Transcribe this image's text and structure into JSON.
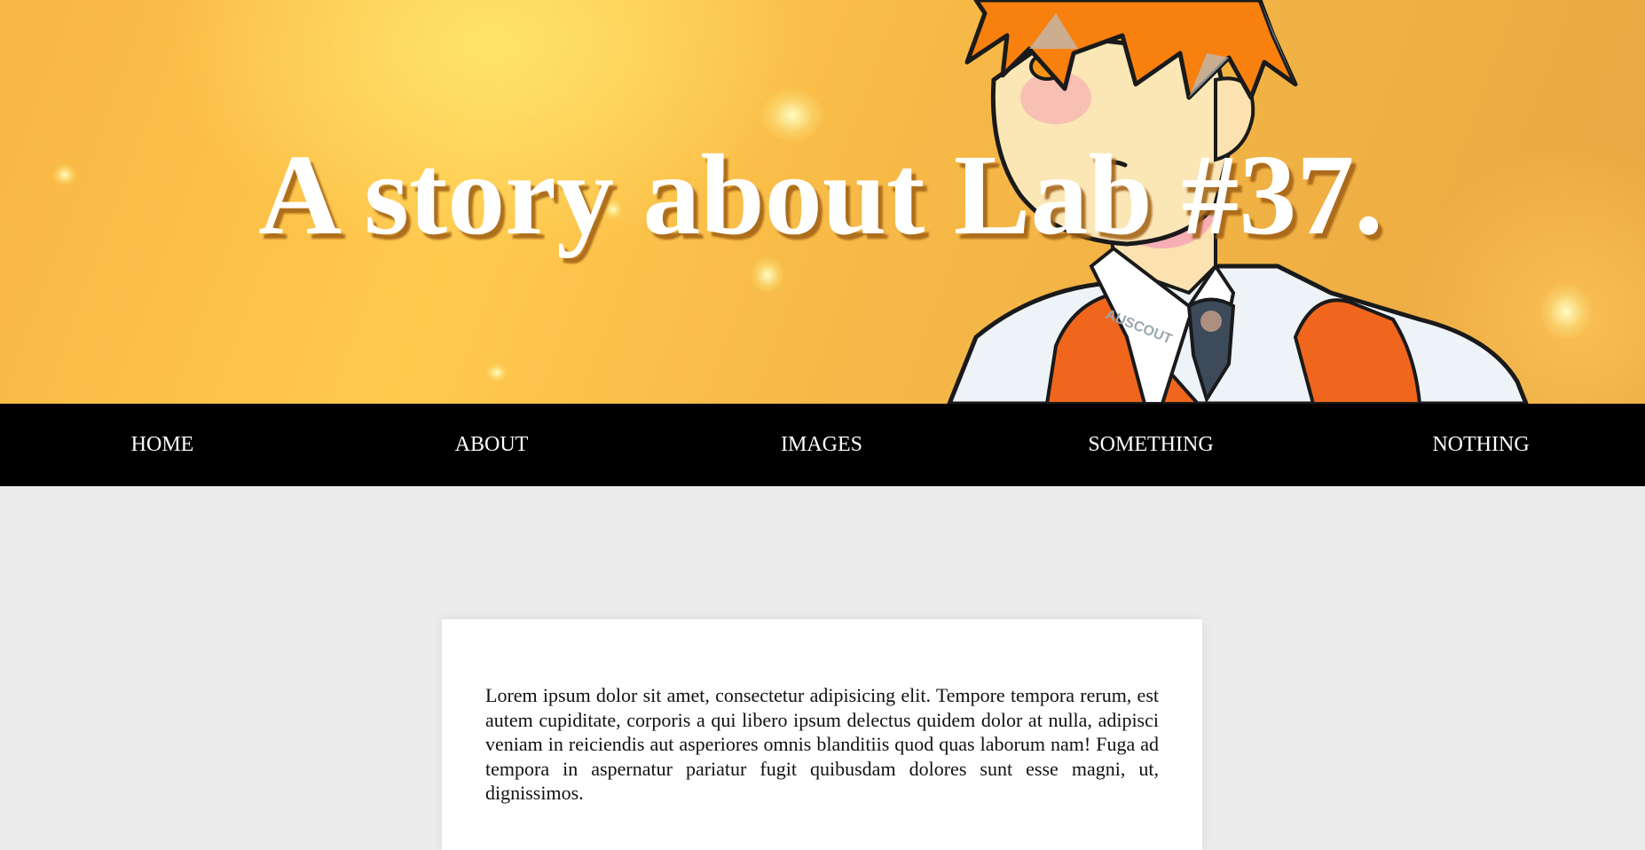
{
  "hero": {
    "title": "A story about Lab #37.",
    "background_color": "#ffc24c",
    "title_color": "#ffffff"
  },
  "nav": {
    "background_color": "#000000",
    "items": [
      {
        "label": "HOME"
      },
      {
        "label": "ABOUT"
      },
      {
        "label": "IMAGES"
      },
      {
        "label": "SOMETHING"
      },
      {
        "label": "NOTHING"
      }
    ]
  },
  "content": {
    "paragraph": "Lorem ipsum dolor sit amet, consectetur adipisicing elit. Tempore tempora rerum, est autem cupiditate, corporis a qui libero ipsum delectus quidem dolor at nulla, adipisci veniam in reiciendis aut asperiores omnis blanditiis quod quas laborum nam! Fuga ad tempora in aspernatur pariatur fugit quibusdam dolores sunt esse magni, ut, dignissimos."
  },
  "illustration": {
    "collar_text": "AUSCOUT"
  }
}
